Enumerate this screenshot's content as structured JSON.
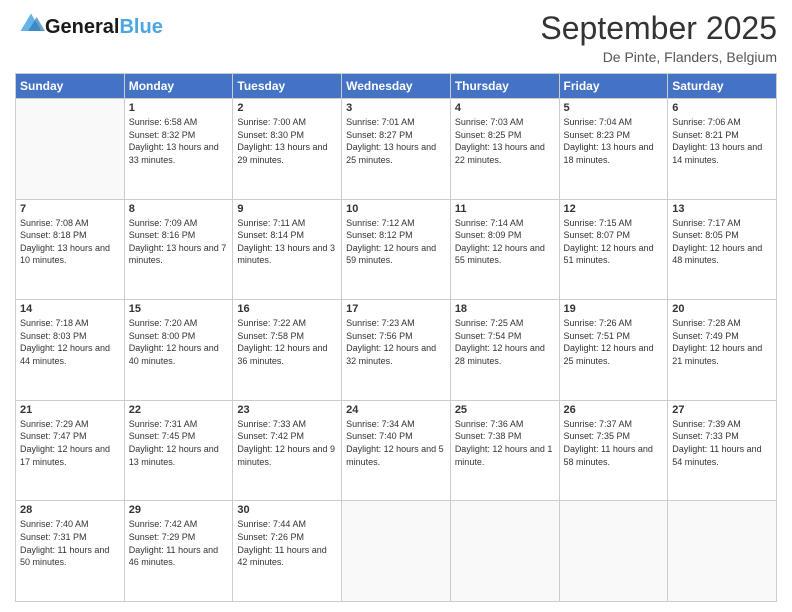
{
  "header": {
    "logo_line1": "General",
    "logo_line2": "Blue",
    "month": "September 2025",
    "location": "De Pinte, Flanders, Belgium"
  },
  "weekdays": [
    "Sunday",
    "Monday",
    "Tuesday",
    "Wednesday",
    "Thursday",
    "Friday",
    "Saturday"
  ],
  "weeks": [
    [
      {
        "day": "",
        "sunrise": "",
        "sunset": "",
        "daylight": ""
      },
      {
        "day": "1",
        "sunrise": "Sunrise: 6:58 AM",
        "sunset": "Sunset: 8:32 PM",
        "daylight": "Daylight: 13 hours and 33 minutes."
      },
      {
        "day": "2",
        "sunrise": "Sunrise: 7:00 AM",
        "sunset": "Sunset: 8:30 PM",
        "daylight": "Daylight: 13 hours and 29 minutes."
      },
      {
        "day": "3",
        "sunrise": "Sunrise: 7:01 AM",
        "sunset": "Sunset: 8:27 PM",
        "daylight": "Daylight: 13 hours and 25 minutes."
      },
      {
        "day": "4",
        "sunrise": "Sunrise: 7:03 AM",
        "sunset": "Sunset: 8:25 PM",
        "daylight": "Daylight: 13 hours and 22 minutes."
      },
      {
        "day": "5",
        "sunrise": "Sunrise: 7:04 AM",
        "sunset": "Sunset: 8:23 PM",
        "daylight": "Daylight: 13 hours and 18 minutes."
      },
      {
        "day": "6",
        "sunrise": "Sunrise: 7:06 AM",
        "sunset": "Sunset: 8:21 PM",
        "daylight": "Daylight: 13 hours and 14 minutes."
      }
    ],
    [
      {
        "day": "7",
        "sunrise": "Sunrise: 7:08 AM",
        "sunset": "Sunset: 8:18 PM",
        "daylight": "Daylight: 13 hours and 10 minutes."
      },
      {
        "day": "8",
        "sunrise": "Sunrise: 7:09 AM",
        "sunset": "Sunset: 8:16 PM",
        "daylight": "Daylight: 13 hours and 7 minutes."
      },
      {
        "day": "9",
        "sunrise": "Sunrise: 7:11 AM",
        "sunset": "Sunset: 8:14 PM",
        "daylight": "Daylight: 13 hours and 3 minutes."
      },
      {
        "day": "10",
        "sunrise": "Sunrise: 7:12 AM",
        "sunset": "Sunset: 8:12 PM",
        "daylight": "Daylight: 12 hours and 59 minutes."
      },
      {
        "day": "11",
        "sunrise": "Sunrise: 7:14 AM",
        "sunset": "Sunset: 8:09 PM",
        "daylight": "Daylight: 12 hours and 55 minutes."
      },
      {
        "day": "12",
        "sunrise": "Sunrise: 7:15 AM",
        "sunset": "Sunset: 8:07 PM",
        "daylight": "Daylight: 12 hours and 51 minutes."
      },
      {
        "day": "13",
        "sunrise": "Sunrise: 7:17 AM",
        "sunset": "Sunset: 8:05 PM",
        "daylight": "Daylight: 12 hours and 48 minutes."
      }
    ],
    [
      {
        "day": "14",
        "sunrise": "Sunrise: 7:18 AM",
        "sunset": "Sunset: 8:03 PM",
        "daylight": "Daylight: 12 hours and 44 minutes."
      },
      {
        "day": "15",
        "sunrise": "Sunrise: 7:20 AM",
        "sunset": "Sunset: 8:00 PM",
        "daylight": "Daylight: 12 hours and 40 minutes."
      },
      {
        "day": "16",
        "sunrise": "Sunrise: 7:22 AM",
        "sunset": "Sunset: 7:58 PM",
        "daylight": "Daylight: 12 hours and 36 minutes."
      },
      {
        "day": "17",
        "sunrise": "Sunrise: 7:23 AM",
        "sunset": "Sunset: 7:56 PM",
        "daylight": "Daylight: 12 hours and 32 minutes."
      },
      {
        "day": "18",
        "sunrise": "Sunrise: 7:25 AM",
        "sunset": "Sunset: 7:54 PM",
        "daylight": "Daylight: 12 hours and 28 minutes."
      },
      {
        "day": "19",
        "sunrise": "Sunrise: 7:26 AM",
        "sunset": "Sunset: 7:51 PM",
        "daylight": "Daylight: 12 hours and 25 minutes."
      },
      {
        "day": "20",
        "sunrise": "Sunrise: 7:28 AM",
        "sunset": "Sunset: 7:49 PM",
        "daylight": "Daylight: 12 hours and 21 minutes."
      }
    ],
    [
      {
        "day": "21",
        "sunrise": "Sunrise: 7:29 AM",
        "sunset": "Sunset: 7:47 PM",
        "daylight": "Daylight: 12 hours and 17 minutes."
      },
      {
        "day": "22",
        "sunrise": "Sunrise: 7:31 AM",
        "sunset": "Sunset: 7:45 PM",
        "daylight": "Daylight: 12 hours and 13 minutes."
      },
      {
        "day": "23",
        "sunrise": "Sunrise: 7:33 AM",
        "sunset": "Sunset: 7:42 PM",
        "daylight": "Daylight: 12 hours and 9 minutes."
      },
      {
        "day": "24",
        "sunrise": "Sunrise: 7:34 AM",
        "sunset": "Sunset: 7:40 PM",
        "daylight": "Daylight: 12 hours and 5 minutes."
      },
      {
        "day": "25",
        "sunrise": "Sunrise: 7:36 AM",
        "sunset": "Sunset: 7:38 PM",
        "daylight": "Daylight: 12 hours and 1 minute."
      },
      {
        "day": "26",
        "sunrise": "Sunrise: 7:37 AM",
        "sunset": "Sunset: 7:35 PM",
        "daylight": "Daylight: 11 hours and 58 minutes."
      },
      {
        "day": "27",
        "sunrise": "Sunrise: 7:39 AM",
        "sunset": "Sunset: 7:33 PM",
        "daylight": "Daylight: 11 hours and 54 minutes."
      }
    ],
    [
      {
        "day": "28",
        "sunrise": "Sunrise: 7:40 AM",
        "sunset": "Sunset: 7:31 PM",
        "daylight": "Daylight: 11 hours and 50 minutes."
      },
      {
        "day": "29",
        "sunrise": "Sunrise: 7:42 AM",
        "sunset": "Sunset: 7:29 PM",
        "daylight": "Daylight: 11 hours and 46 minutes."
      },
      {
        "day": "30",
        "sunrise": "Sunrise: 7:44 AM",
        "sunset": "Sunset: 7:26 PM",
        "daylight": "Daylight: 11 hours and 42 minutes."
      },
      {
        "day": "",
        "sunrise": "",
        "sunset": "",
        "daylight": ""
      },
      {
        "day": "",
        "sunrise": "",
        "sunset": "",
        "daylight": ""
      },
      {
        "day": "",
        "sunrise": "",
        "sunset": "",
        "daylight": ""
      },
      {
        "day": "",
        "sunrise": "",
        "sunset": "",
        "daylight": ""
      }
    ]
  ]
}
